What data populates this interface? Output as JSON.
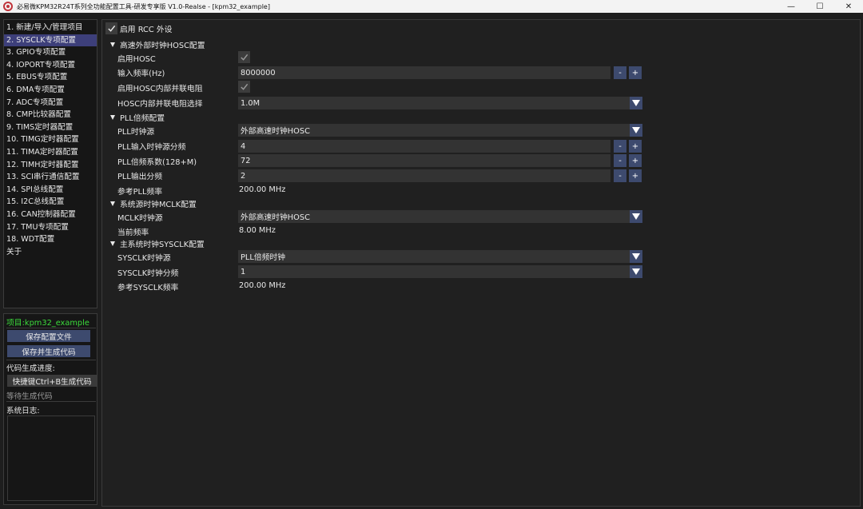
{
  "window": {
    "title": "必易微KPM32R24T系列全功能配置工具-研发专享版 V1.0-Realse - [kpm32_example]",
    "minimize": "—",
    "maximize": "☐",
    "close": "✕"
  },
  "nav": {
    "items": [
      "1. 新建/导入/管理项目",
      "2. SYSCLK专项配置",
      "3. GPIO专项配置",
      "4. IOPORT专项配置",
      "5. EBUS专项配置",
      "6. DMA专项配置",
      "7. ADC专项配置",
      "8. CMP比较器配置",
      "9. TIMS定时器配置",
      "10. TIMG定时器配置",
      "11. TIMA定时器配置",
      "12. TIMH定时器配置",
      "13. SCI串行通信配置",
      "14. SPI总线配置",
      "15. I2C总线配置",
      "16. CAN控制器配置",
      "17. TMU专项配置",
      "18. WDT配置",
      "关于"
    ],
    "active_index": 1
  },
  "project": {
    "name": "项目:kpm32_example",
    "save_button": "保存配置文件",
    "save_generate_button": "保存并生成代码",
    "progress_label": "代码生成进度:",
    "shortcut_button": "快捷键Ctrl+B生成代码",
    "status": "等待生成代码",
    "log_label": "系统日志:"
  },
  "main": {
    "enable_rcc": {
      "label": "启用 RCC 外设",
      "checked": true
    },
    "hosc_section": {
      "title": "高速外部时钟HOSC配置",
      "enable_label": "启用HOSC",
      "enable_checked": true,
      "freq_label": "输入频率(Hz)",
      "freq_value": "8000000",
      "parallel_res_label": "启用HOSC内部并联电阻",
      "parallel_res_checked": true,
      "res_select_label": "HOSC内部并联电阻选择",
      "res_select_value": "1.0M"
    },
    "pll_section": {
      "title": "PLL倍频配置",
      "source_label": "PLL时钟源",
      "source_value": "外部高速时钟HOSC",
      "input_div_label": "PLL输入时钟源分频",
      "input_div_value": "4",
      "mult_label": "PLL倍频系数(128+M)",
      "mult_value": "72",
      "output_div_label": "PLL输出分频",
      "output_div_value": "2",
      "ref_freq_label": "参考PLL频率",
      "ref_freq_value": "200.00 MHz"
    },
    "mclk_section": {
      "title": "系统源时钟MCLK配置",
      "source_label": "MCLK时钟源",
      "source_value": "外部高速时钟HOSC",
      "cur_freq_label": "当前频率",
      "cur_freq_value": "8.00 MHz"
    },
    "sysclk_section": {
      "title": "主系统时钟SYSCLK配置",
      "source_label": "SYSCLK时钟源",
      "source_value": "PLL倍频时钟",
      "div_label": "SYSCLK时钟分频",
      "div_value": "1",
      "ref_freq_label": "参考SYSCLK频率",
      "ref_freq_value": "200.00 MHz"
    },
    "stepper": {
      "minus": "-",
      "plus": "+"
    }
  },
  "colors": {
    "accent": "#3d4a6e",
    "active_nav": "#3d3f7a",
    "project_name": "#3cdc3c"
  }
}
